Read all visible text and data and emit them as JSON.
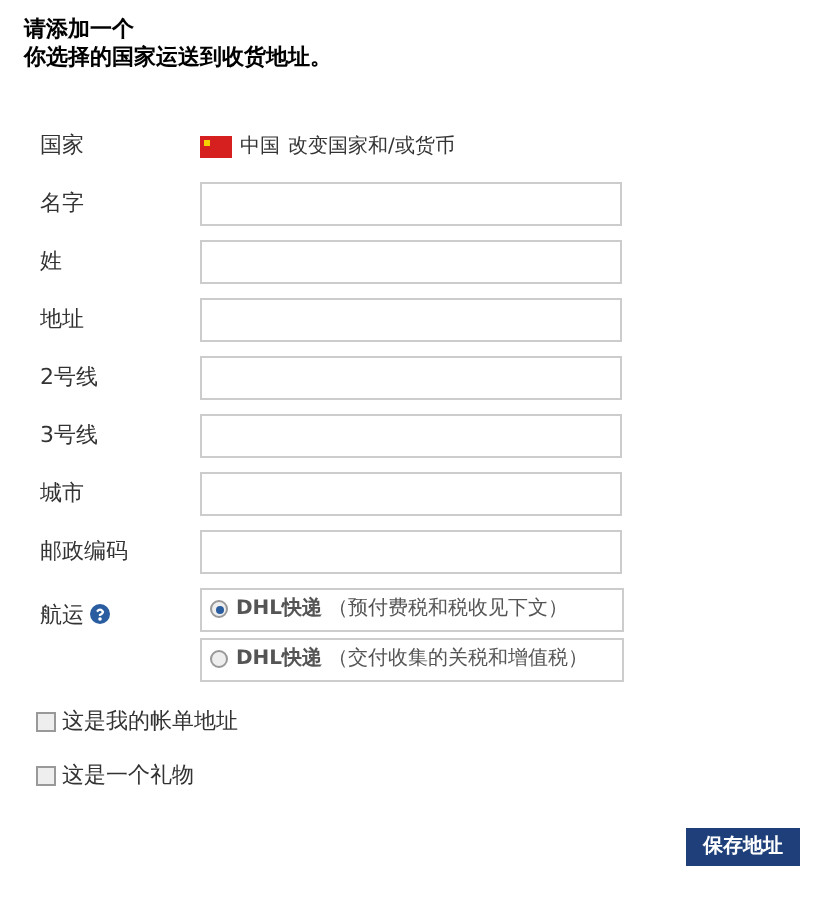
{
  "heading": [
    "请添加一个",
    "你选择的国家运送到收货地址。"
  ],
  "country": {
    "label": "国家",
    "value": "中国",
    "change_link": "改变国家和/或货币"
  },
  "fields": [
    {
      "label": "名字"
    },
    {
      "label": "姓"
    },
    {
      "label": "地址"
    },
    {
      "label": "2号线"
    },
    {
      "label": "3号线"
    },
    {
      "label": "城市"
    },
    {
      "label": "邮政编码"
    }
  ],
  "shipping": {
    "label": "航运",
    "options": [
      {
        "text": "**DHL快递** （预付费税和税收见下文）",
        "selected": true
      },
      {
        "text": "**DHL快递** （交付收集的关税和增值税）",
        "selected": false
      }
    ]
  },
  "checkboxes": [
    {
      "label": "这是我的帐单地址",
      "checked": false
    },
    {
      "label": "这是一个礼物",
      "checked": false
    }
  ],
  "save_button": "保存地址"
}
